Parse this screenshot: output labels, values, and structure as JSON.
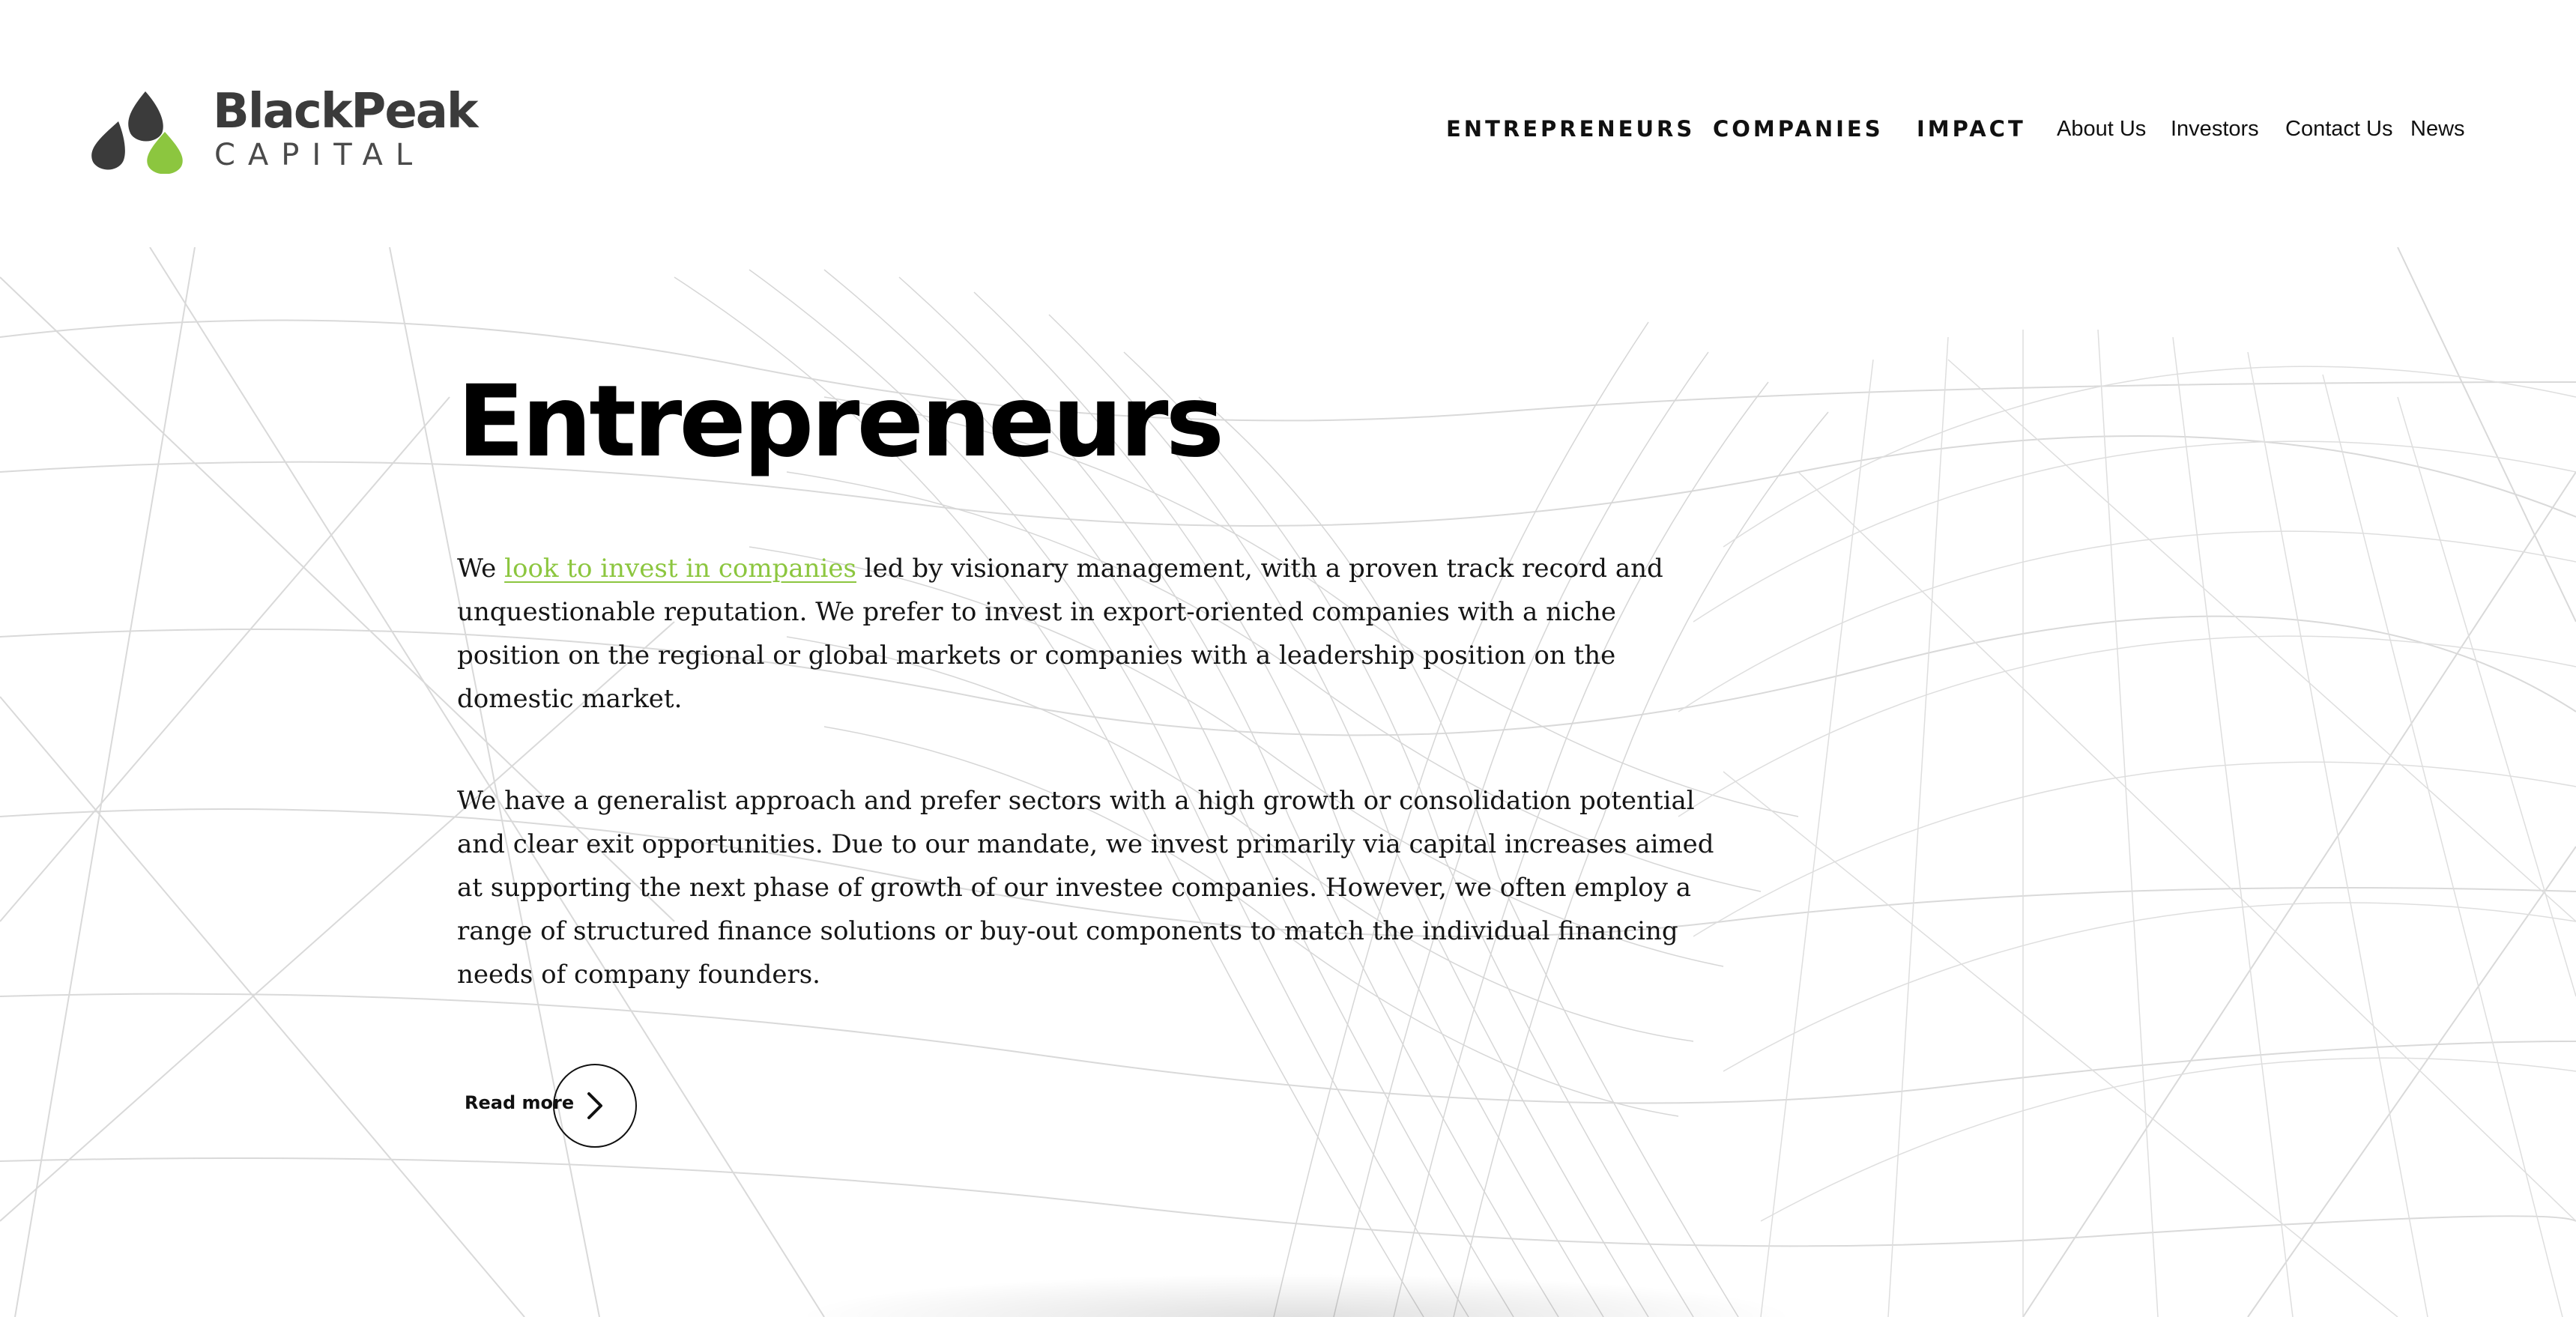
{
  "brand": {
    "name": "BlackPeak",
    "tagline": "CAPITAL",
    "accent_color": "#8cc63f",
    "dark_color": "#3b3b3b"
  },
  "nav": {
    "entrepreneurs": "ENTREPRENEURS",
    "companies": "COMPANIES",
    "impact": "IMPACT",
    "about": "About Us",
    "investors": "Investors",
    "contact": "Contact Us",
    "news": "News"
  },
  "hero": {
    "title": "Entrepreneurs",
    "para1_before": "We ",
    "para1_link": "look to invest in companies",
    "para1_after": " led by visionary management, with a proven track record and unquestionable reputation. We prefer to invest in export-oriented companies with a niche position on the regional or global markets or companies with a leadership position on the domestic market.",
    "para2": "We have a generalist approach and prefer sectors with a high growth or consolidation potential and clear exit opportunities. Due to our mandate, we invest primarily via capital increases aimed at supporting the next phase of growth of our investee companies. However, we often employ a range of structured finance solutions or buy-out components to match the individual financing needs of company founders.",
    "read_more": "Read more",
    "read_more_icon": "chevron-right-icon"
  }
}
